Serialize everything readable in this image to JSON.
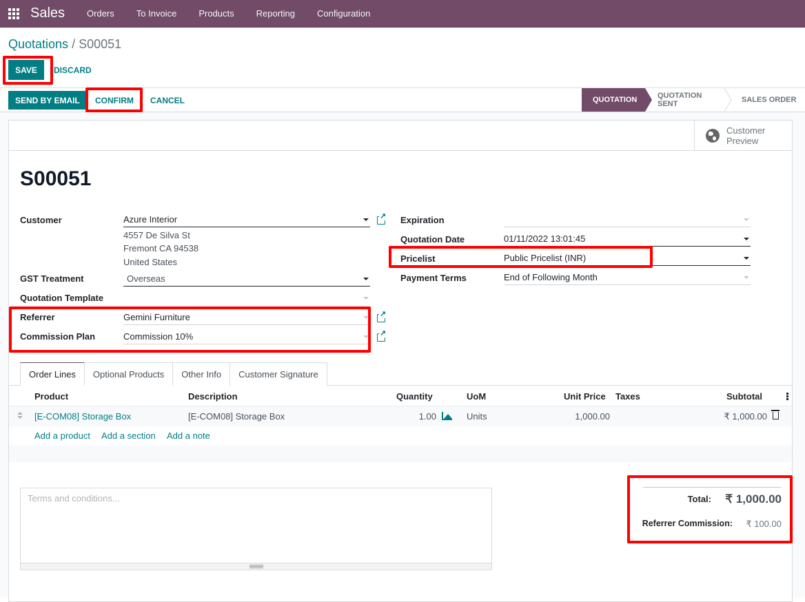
{
  "navbar": {
    "app_name": "Sales",
    "menu": [
      "Orders",
      "To Invoice",
      "Products",
      "Reporting",
      "Configuration"
    ]
  },
  "breadcrumb": {
    "parent": "Quotations",
    "separator": " / ",
    "current": "S00051"
  },
  "form_buttons": {
    "save": "SAVE",
    "discard": "DISCARD"
  },
  "status_actions": {
    "send_by_email": "SEND BY EMAIL",
    "confirm": "CONFIRM",
    "cancel": "CANCEL"
  },
  "stages": [
    {
      "label": "QUOTATION",
      "active": true
    },
    {
      "label": "QUOTATION SENT",
      "active": false
    },
    {
      "label": "SALES ORDER",
      "active": false
    }
  ],
  "smart_buttons": {
    "customer_preview_line1": "Customer",
    "customer_preview_line2": "Preview"
  },
  "record": {
    "name": "S00051"
  },
  "left_fields": {
    "customer_label": "Customer",
    "customer_value": "Azure Interior",
    "address_line1": "4557 De Silva St",
    "address_line2": "Fremont CA 94538",
    "address_line3": "United States",
    "gst_label": "GST Treatment",
    "gst_value": "Overseas",
    "template_label": "Quotation Template",
    "template_value": "",
    "referrer_label": "Referrer",
    "referrer_value": "Gemini Furniture",
    "commission_label": "Commission Plan",
    "commission_value": "Commission 10%"
  },
  "right_fields": {
    "expiration_label": "Expiration",
    "expiration_value": "",
    "date_label": "Quotation Date",
    "date_value": "01/11/2022 13:01:45",
    "pricelist_label": "Pricelist",
    "pricelist_value": "Public Pricelist (INR)",
    "terms_label": "Payment Terms",
    "terms_value": "End of Following Month"
  },
  "tabs": [
    "Order Lines",
    "Optional Products",
    "Other Info",
    "Customer Signature"
  ],
  "order_lines": {
    "columns": {
      "product": "Product",
      "description": "Description",
      "quantity": "Quantity",
      "uom": "UoM",
      "unit_price": "Unit Price",
      "taxes": "Taxes",
      "subtotal": "Subtotal"
    },
    "rows": [
      {
        "product": "[E-COM08] Storage Box",
        "description": "[E-COM08] Storage Box",
        "quantity": "1.00",
        "uom": "Units",
        "unit_price": "1,000.00",
        "taxes": "",
        "subtotal": "₹ 1,000.00"
      }
    ],
    "add_product": "Add a product",
    "add_section": "Add a section",
    "add_note": "Add a note"
  },
  "terms": {
    "placeholder": "Terms and conditions..."
  },
  "totals": {
    "total_label": "Total:",
    "total_value": "₹ 1,000.00",
    "commission_label": "Referrer Commission:",
    "commission_value": "₹ 100.00"
  },
  "colors": {
    "brand": "#714B67",
    "accent": "#017e84",
    "highlight": "#ff0000"
  }
}
